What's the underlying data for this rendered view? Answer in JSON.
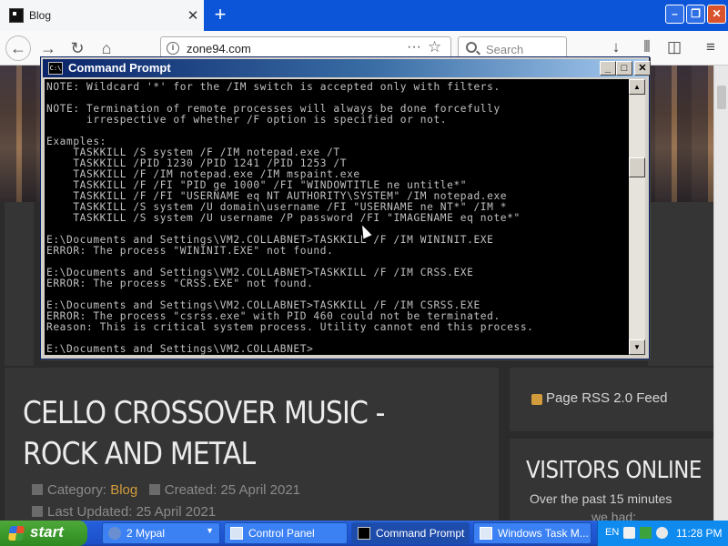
{
  "browser": {
    "tab_title": "Blog",
    "tab_close": "✕",
    "new_tab": "+",
    "window_min": "–",
    "window_max": "❐",
    "window_close": "✕",
    "url": "zone94.com",
    "search_placeholder": "Search",
    "icons": [
      "back-icon",
      "forward-icon",
      "reload-icon",
      "home-icon",
      "info-icon",
      "page-actions-icon",
      "bookmark-star-icon",
      "search-icon",
      "download-icon",
      "library-icon",
      "sidebar-icon",
      "menu-icon"
    ]
  },
  "page": {
    "article_title": "CELLO CROSSOVER MUSIC - ROCK AND METAL",
    "category_label": "Category: ",
    "category_value": "Blog",
    "created": "Created: 25 April 2021",
    "last_updated": "Last Updated: 25 April 2021",
    "rss": "Page RSS 2.0 Feed",
    "visitors_title": "VISITORS ONLINE",
    "visitors_sub": "Over the past 15 minutes",
    "visitors_sub2": "we had:"
  },
  "cmd": {
    "title": "Command Prompt",
    "min": "_",
    "max": "□",
    "close": "✕",
    "lines": [
      "NOTE: Wildcard '*' for the /IM switch is accepted only with filters.",
      "",
      "NOTE: Termination of remote processes will always be done forcefully",
      "      irrespective of whether /F option is specified or not.",
      "",
      "Examples:",
      "    TASKKILL /S system /F /IM notepad.exe /T",
      "    TASKKILL /PID 1230 /PID 1241 /PID 1253 /T",
      "    TASKKILL /F /IM notepad.exe /IM mspaint.exe",
      "    TASKKILL /F /FI \"PID ge 1000\" /FI \"WINDOWTITLE ne untitle*\"",
      "    TASKKILL /F /FI \"USERNAME eq NT AUTHORITY\\SYSTEM\" /IM notepad.exe",
      "    TASKKILL /S system /U domain\\username /FI \"USERNAME ne NT*\" /IM *",
      "    TASKKILL /S system /U username /P password /FI \"IMAGENAME eq note*\"",
      "",
      "E:\\Documents and Settings\\VM2.COLLABNET>TASKKILL /F /IM WININIT.EXE",
      "ERROR: The process \"WININIT.EXE\" not found.",
      "",
      "E:\\Documents and Settings\\VM2.COLLABNET>TASKKILL /F /IM CRSS.EXE",
      "ERROR: The process \"CRSS.EXE\" not found.",
      "",
      "E:\\Documents and Settings\\VM2.COLLABNET>TASKKILL /F /IM CSRSS.EXE",
      "ERROR: The process \"csrss.exe\" with PID 460 could not be terminated.",
      "Reason: This is critical system process. Utility cannot end this process.",
      "",
      "E:\\Documents and Settings\\VM2.COLLABNET>"
    ]
  },
  "taskbar": {
    "start": "start",
    "items": [
      {
        "label": "2 Mypal",
        "icon": "mypal-icon"
      },
      {
        "label": "Control Panel",
        "icon": "control-panel-icon"
      },
      {
        "label": "Command Prompt",
        "icon": "cmd-icon"
      },
      {
        "label": "Windows Task M...",
        "icon": "task-manager-icon"
      }
    ],
    "lang": "EN",
    "time": "11:28 PM"
  },
  "colors": {
    "xp_taskbar": "#245edb",
    "start_green": "#3c9a2c",
    "accent_orange": "#d29c3c",
    "console_bg": "#000000",
    "console_text": "#c0c0c0"
  }
}
